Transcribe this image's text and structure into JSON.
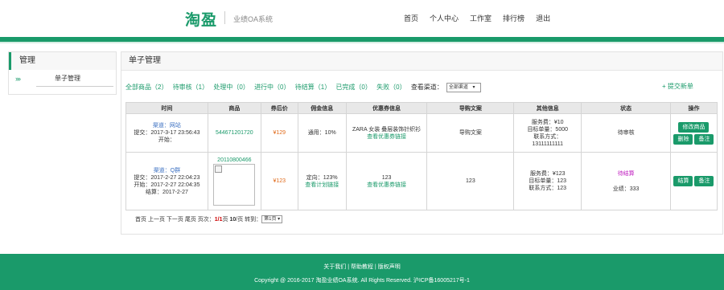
{
  "header": {
    "logo": "淘盈",
    "subtitle": "业绩OA系统",
    "nav": [
      "首页",
      "个人中心",
      "工作室",
      "排行榜",
      "退出"
    ]
  },
  "sidebar": {
    "title": "管理",
    "items": [
      {
        "label": "单子管理"
      }
    ]
  },
  "main": {
    "title": "单子管理",
    "filters": [
      {
        "label": "全部商品（2）"
      },
      {
        "label": "待审核（1）"
      },
      {
        "label": "处理中（0）"
      },
      {
        "label": "进行中（0）"
      },
      {
        "label": "待结算（1）"
      },
      {
        "label": "已完成（0）"
      },
      {
        "label": "失败（0）"
      }
    ],
    "channel_label": "查看渠道：",
    "channel_value": "全部渠道",
    "submit_label": "+ 提交新单",
    "columns": [
      "时间",
      "商品",
      "券后价",
      "佣金信息",
      "优惠券信息",
      "导购文案",
      "其他信息",
      "状态",
      "操作"
    ],
    "rows": [
      {
        "channel": "渠道：网站",
        "submit": "提交：2017-3-17 23:56:43",
        "start": "开始：",
        "end": "",
        "product_id": "544671201720",
        "price": "¥129",
        "commission": "通用：10%",
        "commission_link": "",
        "coupon": "ZARA 女装 叠层装饰针织衫",
        "coupon_link": "查看优惠券链接",
        "copy": "导购文案",
        "other": [
          "服务费：¥10",
          "目标单量：5000",
          "联系方式：",
          "13111111111"
        ],
        "status": "待审核",
        "status_extra": "",
        "actions": [
          "修改商品",
          "删除",
          "备注"
        ]
      },
      {
        "channel": "渠道：Q群",
        "submit": "提交：2017-2-27 22:04:23",
        "start": "开始：2017-2-27 22:04:35",
        "end": "结算：2017-2-27",
        "product_id": "20110800466",
        "price": "¥123",
        "commission": "定向：123%",
        "commission_link": "查看计划链接",
        "coupon": "123",
        "coupon_link": "查看优惠券链接",
        "copy": "123",
        "other": [
          "服务费：¥123",
          "目标单量：123",
          "联系方式：123"
        ],
        "status": "待结算",
        "status_extra": "业绩：333",
        "actions": [
          "结算",
          "备注"
        ]
      }
    ],
    "pager": {
      "text_prefix": "首页 上一页 下一页 尾页 页次：",
      "current": "1/1",
      "unit1": "页",
      "per_page": "10",
      "text_mid": "/页 转到：",
      "goto_value": "第1页"
    }
  },
  "footer": {
    "links": "关于我们 | 帮助教程 | 版权声明",
    "copyright": "Copyright @ 2016-2017 淘盈业绩OA系统. All Rights Reserved. 沪ICP备16005217号-1"
  },
  "colors": {
    "accent": "#1a9a6a",
    "link": "#3a6fc1",
    "price": "#e06a1a",
    "pending_settle": "#c020c0"
  }
}
